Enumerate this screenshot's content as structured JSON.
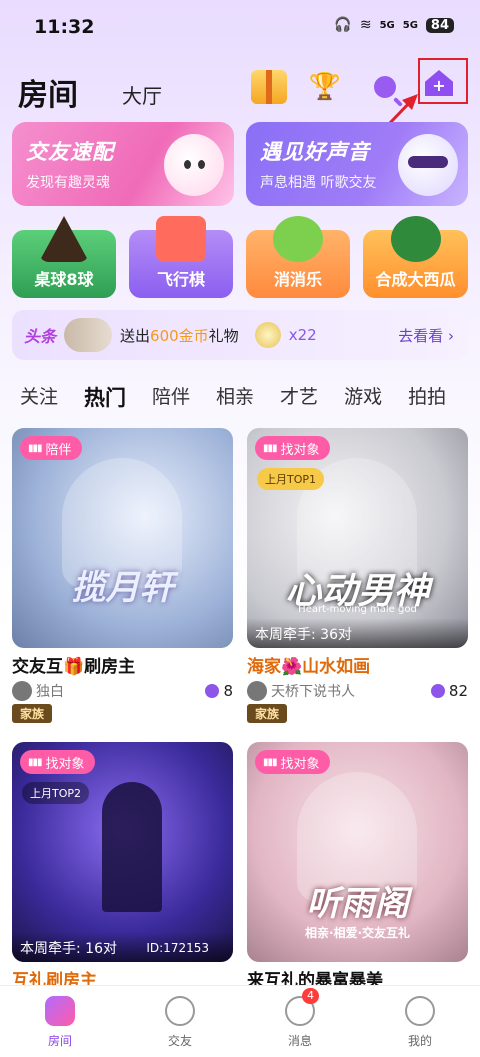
{
  "status_bar": {
    "time": "11:32",
    "network_1": "5G",
    "network_2": "5G",
    "battery": "84"
  },
  "header": {
    "tab_room": "房间",
    "tab_hall": "大厅"
  },
  "banners": [
    {
      "title": "交友速配",
      "subtitle": "发现有趣灵魂"
    },
    {
      "title": "遇见好声音",
      "subtitle": "声息相遇 听歌交友"
    }
  ],
  "games": [
    {
      "label": "桌球8球"
    },
    {
      "label": "飞行棋"
    },
    {
      "label": "消消乐"
    },
    {
      "label": "合成大西瓜"
    }
  ],
  "headline": {
    "tag": "头条",
    "text_prefix": "送出",
    "amount": "600金币",
    "text_suffix": "礼物",
    "count": "x22",
    "more": "去看看"
  },
  "categories": [
    "关注",
    "热门",
    "陪伴",
    "相亲",
    "才艺",
    "游戏",
    "拍拍"
  ],
  "cards": [
    {
      "tag": "陪伴",
      "overlay": "揽月轩",
      "title": "交友互🎁刷房主",
      "owner": "独白",
      "count": "8",
      "family": "家族"
    },
    {
      "tag": "找对象",
      "badge": "上月TOP1",
      "overlay": "心动男神",
      "overlay_sub": "Heart-moving male god",
      "weekly": "本周牵手: 36对",
      "title": "海家🌺山水如画",
      "owner": "天桥下说书人",
      "count": "82",
      "family": "家族"
    },
    {
      "tag": "找对象",
      "badge": "上月TOP2",
      "weekly": "本周牵手: 16对",
      "id_text": "ID:172153",
      "title": "互礼刷房主"
    },
    {
      "tag": "找对象",
      "overlay": "听雨阁",
      "overlay_sub": "相亲·相爱·交友互礼",
      "title": "来互礼的暴富暴美"
    }
  ],
  "nav": [
    {
      "label": "房间"
    },
    {
      "label": "交友"
    },
    {
      "label": "消息",
      "badge": "4"
    },
    {
      "label": "我的"
    }
  ]
}
